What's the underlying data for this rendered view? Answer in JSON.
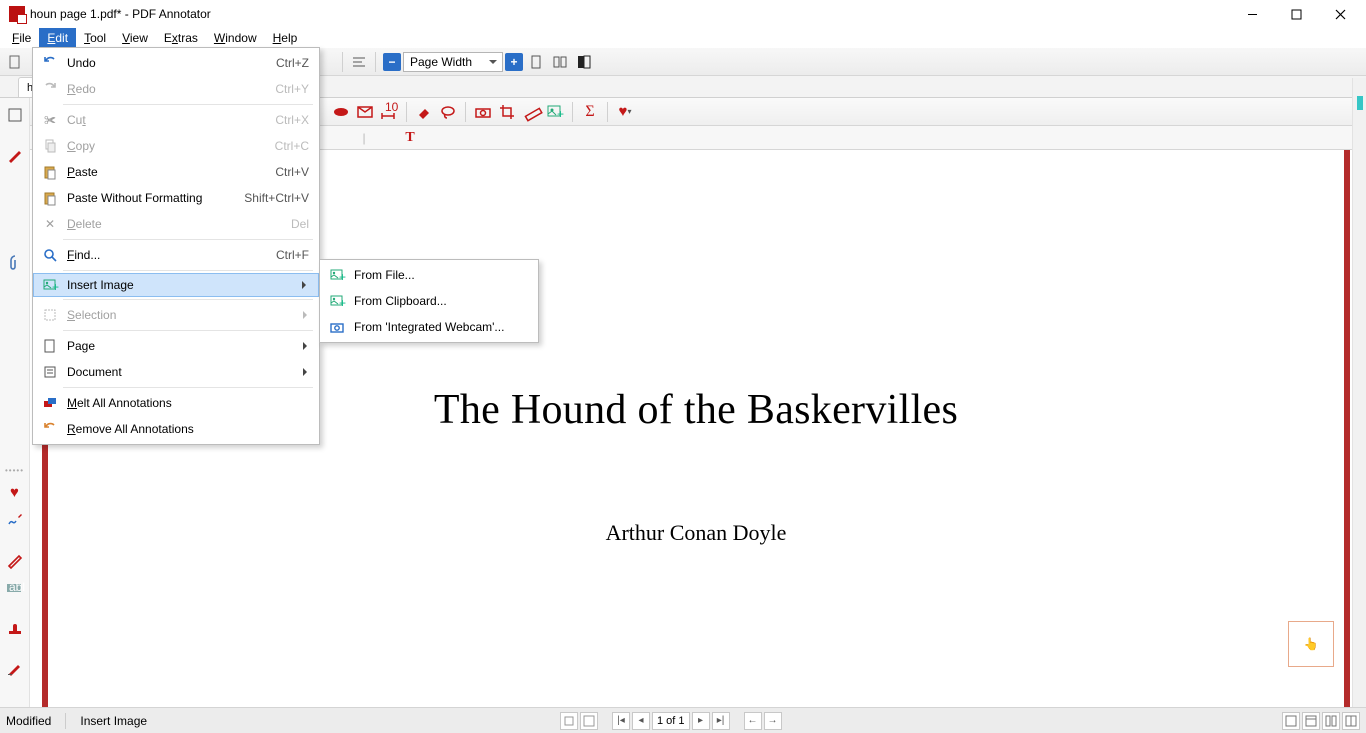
{
  "window": {
    "title": "houn page 1.pdf* - PDF Annotator"
  },
  "menubar": {
    "file": "File",
    "edit": "Edit",
    "tool": "Tool",
    "view": "View",
    "extras": "Extras",
    "window": "Window",
    "help": "Help"
  },
  "zoom": {
    "label": "Page Width"
  },
  "tab": {
    "label": "ho"
  },
  "edit_menu": {
    "undo": "Undo",
    "undo_sc": "Ctrl+Z",
    "redo": "Redo",
    "redo_sc": "Ctrl+Y",
    "cut": "Cut",
    "cut_sc": "Ctrl+X",
    "copy": "Copy",
    "copy_sc": "Ctrl+C",
    "paste": "Paste",
    "paste_sc": "Ctrl+V",
    "paste_wo": "Paste Without Formatting",
    "paste_wo_sc": "Shift+Ctrl+V",
    "delete": "Delete",
    "delete_sc": "Del",
    "find": "Find...",
    "find_sc": "Ctrl+F",
    "insert_image": "Insert Image",
    "selection": "Selection",
    "page": "Page",
    "document": "Document",
    "melt": "Melt All Annotations",
    "remove": "Remove All Annotations"
  },
  "insert_submenu": {
    "from_file": "From File...",
    "from_clipboard": "From Clipboard...",
    "from_webcam": "From 'Integrated Webcam'..."
  },
  "document": {
    "title": "The Hound of the Baskervilles",
    "author": "Arthur Conan Doyle"
  },
  "statusbar": {
    "modified": "Modified",
    "context": "Insert Image",
    "page": "1 of 1"
  }
}
